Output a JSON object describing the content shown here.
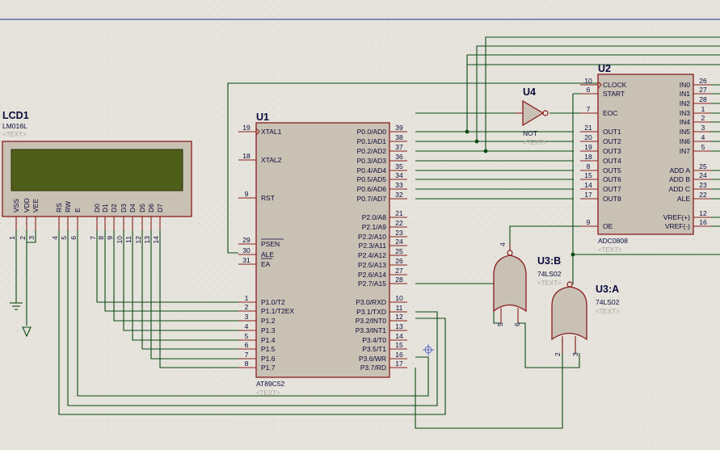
{
  "colors": {
    "background": "#e5e3dc",
    "wire": "#0c4a10",
    "component_outline": "#8b1d1d",
    "component_fill": "#c9c1b4",
    "lcd_screen": "#4f5f1a",
    "text": "#0a0a3a",
    "placeholder_text": "#a8a69e",
    "top_border": "#2b2f8a",
    "cursor": "#5a6ac0"
  },
  "lcd": {
    "ref": "LCD1",
    "model": "LM016L",
    "text_placeholder": "<TEXT>",
    "pins": [
      {
        "name": "VSS",
        "num": "1"
      },
      {
        "name": "VDD",
        "num": "2"
      },
      {
        "name": "VEE",
        "num": "3"
      },
      {
        "name": "RS",
        "num": "4"
      },
      {
        "name": "RW",
        "num": "5"
      },
      {
        "name": "E",
        "num": "6"
      },
      {
        "name": "D0",
        "num": "7"
      },
      {
        "name": "D1",
        "num": "8"
      },
      {
        "name": "D2",
        "num": "9"
      },
      {
        "name": "D3",
        "num": "10"
      },
      {
        "name": "D4",
        "num": "11"
      },
      {
        "name": "D5",
        "num": "12"
      },
      {
        "name": "D6",
        "num": "13"
      },
      {
        "name": "D7",
        "num": "14"
      }
    ]
  },
  "u1": {
    "ref": "U1",
    "model": "AT89C52",
    "text_placeholder": "<TEXT>",
    "left_pins": [
      {
        "name": "XTAL1",
        "num": "19"
      },
      {
        "name": "XTAL2",
        "num": "18"
      },
      {
        "name": "RST",
        "num": "9"
      },
      {
        "name": "PSEN",
        "num": "29"
      },
      {
        "name": "ALE",
        "num": "30"
      },
      {
        "name": "EA",
        "num": "31"
      },
      {
        "name": "P1.0/T2",
        "num": "1"
      },
      {
        "name": "P1.1/T2EX",
        "num": "2"
      },
      {
        "name": "P1.2",
        "num": "3"
      },
      {
        "name": "P1.3",
        "num": "4"
      },
      {
        "name": "P1.4",
        "num": "5"
      },
      {
        "name": "P1.5",
        "num": "6"
      },
      {
        "name": "P1.6",
        "num": "7"
      },
      {
        "name": "P1.7",
        "num": "8"
      }
    ],
    "right_pins": [
      {
        "name": "P0.0/AD0",
        "num": "39"
      },
      {
        "name": "P0.1/AD1",
        "num": "38"
      },
      {
        "name": "P0.2/AD2",
        "num": "37"
      },
      {
        "name": "P0.3/AD3",
        "num": "36"
      },
      {
        "name": "P0.4/AD4",
        "num": "35"
      },
      {
        "name": "P0.5/AD5",
        "num": "34"
      },
      {
        "name": "P0.6/AD6",
        "num": "33"
      },
      {
        "name": "P0.7/AD7",
        "num": "32"
      },
      {
        "name": "P2.0/A8",
        "num": "21"
      },
      {
        "name": "P2.1/A9",
        "num": "22"
      },
      {
        "name": "P2.2/A10",
        "num": "23"
      },
      {
        "name": "P2.3/A11",
        "num": "24"
      },
      {
        "name": "P2.4/A12",
        "num": "25"
      },
      {
        "name": "P2.5/A13",
        "num": "26"
      },
      {
        "name": "P2.6/A14",
        "num": "27"
      },
      {
        "name": "P2.7/A15",
        "num": "28"
      },
      {
        "name": "P3.0/RXD",
        "num": "10"
      },
      {
        "name": "P3.1/TXD",
        "num": "11"
      },
      {
        "name": "P3.2/INT0",
        "num": "12"
      },
      {
        "name": "P3.3/INT1",
        "num": "13"
      },
      {
        "name": "P3.4/T0",
        "num": "14"
      },
      {
        "name": "P3.5/T1",
        "num": "15"
      },
      {
        "name": "P3.6/WR",
        "num": "16"
      },
      {
        "name": "P3.7/RD",
        "num": "17"
      }
    ]
  },
  "u2": {
    "ref": "U2",
    "model": "ADC0808",
    "text_placeholder": "<TEXT>",
    "left_pins": [
      {
        "name": "CLOCK",
        "num": "10"
      },
      {
        "name": "START",
        "num": "6"
      },
      {
        "name": "EOC",
        "num": "7"
      },
      {
        "name": "OUT1",
        "num": "21"
      },
      {
        "name": "OUT2",
        "num": "20"
      },
      {
        "name": "OUT3",
        "num": "19"
      },
      {
        "name": "OUT4",
        "num": "18"
      },
      {
        "name": "OUT5",
        "num": "8"
      },
      {
        "name": "OUT6",
        "num": "15"
      },
      {
        "name": "OUT7",
        "num": "14"
      },
      {
        "name": "OUT8",
        "num": "17"
      },
      {
        "name": "OE",
        "num": "9"
      }
    ],
    "right_pins": [
      {
        "name": "IN0",
        "num": "26"
      },
      {
        "name": "IN1",
        "num": "27"
      },
      {
        "name": "IN2",
        "num": "28"
      },
      {
        "name": "IN3",
        "num": "1"
      },
      {
        "name": "IN4",
        "num": "2"
      },
      {
        "name": "IN5",
        "num": "3"
      },
      {
        "name": "IN6",
        "num": "4"
      },
      {
        "name": "IN7",
        "num": "5"
      },
      {
        "name": "ADD A",
        "num": "25"
      },
      {
        "name": "ADD B",
        "num": "24"
      },
      {
        "name": "ADD C",
        "num": "23"
      },
      {
        "name": "ALE",
        "num": "22"
      },
      {
        "name": "VREF(+)",
        "num": "12"
      },
      {
        "name": "VREF(-)",
        "num": "16"
      }
    ]
  },
  "u4": {
    "ref": "U4",
    "model": "NOT",
    "text_placeholder": "<TEXT>"
  },
  "u3b": {
    "ref": "U3:B",
    "model": "74LS02",
    "text_placeholder": "<TEXT>",
    "pin_out": "4",
    "pin_a": "5",
    "pin_b": "6"
  },
  "u3a": {
    "ref": "U3:A",
    "model": "74LS02",
    "text_placeholder": "<TEXT>",
    "pin_out": "1",
    "pin_a": "2",
    "pin_b": "3"
  }
}
